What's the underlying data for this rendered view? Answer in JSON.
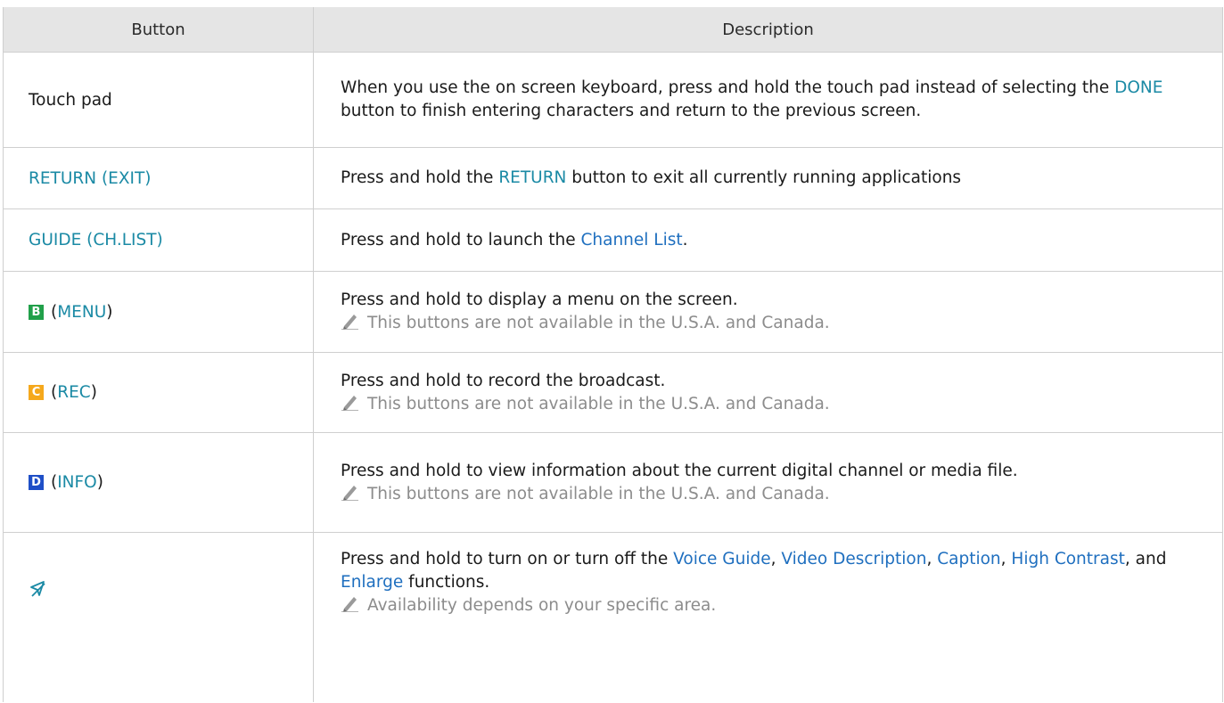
{
  "table": {
    "header": {
      "col1": "Button",
      "col2": "Description"
    },
    "rows": [
      {
        "button": "Touch pad",
        "desc_1": "When you use the on screen keyboard, press and hold the touch pad instead of selecting the ",
        "desc_kw": "DONE",
        "desc_2": " button to finish entering characters and return to the previous screen."
      },
      {
        "button": "RETURN (EXIT)",
        "desc_1": "Press and hold the ",
        "desc_kw": "RETURN",
        "desc_2": " button to exit all currently running applications"
      },
      {
        "button": "GUIDE (CH.LIST)",
        "desc_1": "Press and hold to launch the ",
        "desc_link": "Channel List",
        "desc_2": "."
      },
      {
        "key": "B",
        "key_color": "#21a04a",
        "button_open": "(",
        "button_kw": "MENU",
        "button_close": ")",
        "desc": "Press and hold to display a menu on the screen.",
        "note": "This buttons are not available in the U.S.A. and Canada."
      },
      {
        "key": "C",
        "key_color": "#f5a81c",
        "button_open": "(",
        "button_kw": "REC",
        "button_close": ")",
        "desc": "Press and hold to record the broadcast.",
        "note": "This buttons are not available in the U.S.A. and Canada."
      },
      {
        "key": "D",
        "key_color": "#1f4fc7",
        "button_open": "(",
        "button_kw": "INFO",
        "button_close": ")",
        "desc": "Press and hold to view information about the current digital channel or media file.",
        "note": "This buttons are not available in the U.S.A. and Canada."
      },
      {
        "button_icon": "accessibility-icon",
        "desc_1": "Press and hold to turn on or turn off the ",
        "link_1": "Voice Guide",
        "sep_1": ", ",
        "link_2": "Video Description",
        "sep_2": ", ",
        "link_3": "Caption",
        "sep_3": ", ",
        "link_4": "High Contrast",
        "sep_4": ", and ",
        "link_5": "Enlarge",
        "desc_2": " functions.",
        "note": "Availability depends on your specific area."
      }
    ]
  },
  "colors": {
    "keyword": "#1b8aa5",
    "link": "#1f6fbf",
    "header_bg": "#e5e5e5",
    "note": "#8c8c8c"
  }
}
